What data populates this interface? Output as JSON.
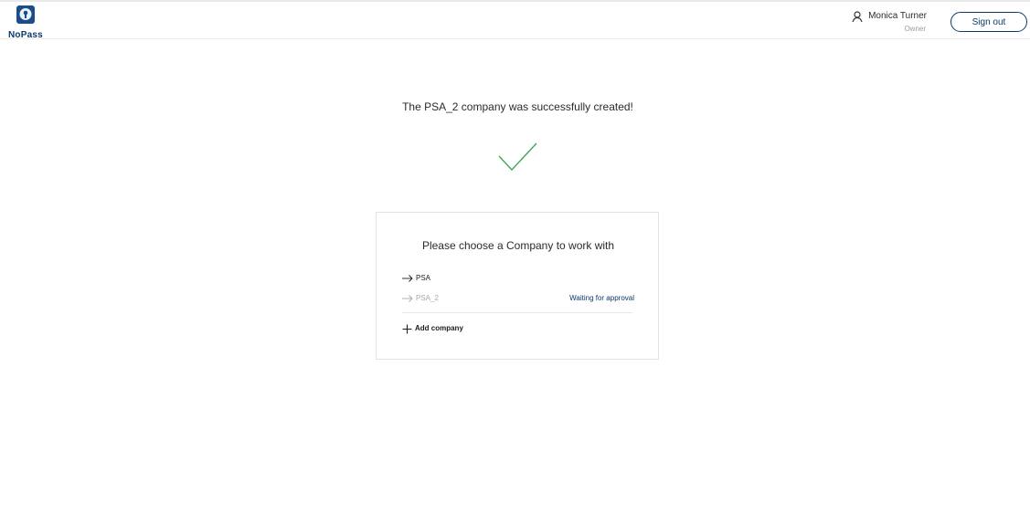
{
  "header": {
    "logo_text": "NoPass",
    "logo_icon": "keyhole-shield-icon",
    "user": {
      "name": "Monica Turner",
      "role": "Owner",
      "icon": "user-icon"
    },
    "sign_out_label": "Sign out"
  },
  "main": {
    "success_message": "The PSA_2 company was successfully created!",
    "success_icon": "checkmark-icon",
    "card": {
      "title": "Please choose a Company to work with",
      "companies": [
        {
          "name": "PSA",
          "status": ""
        },
        {
          "name": "PSA_2",
          "status": "Waiting for approval"
        }
      ],
      "add_company_label": "Add company"
    }
  },
  "colors": {
    "brand": "#0b3a6b",
    "success": "#3aa655",
    "pending_text": "#a8a8a8"
  }
}
